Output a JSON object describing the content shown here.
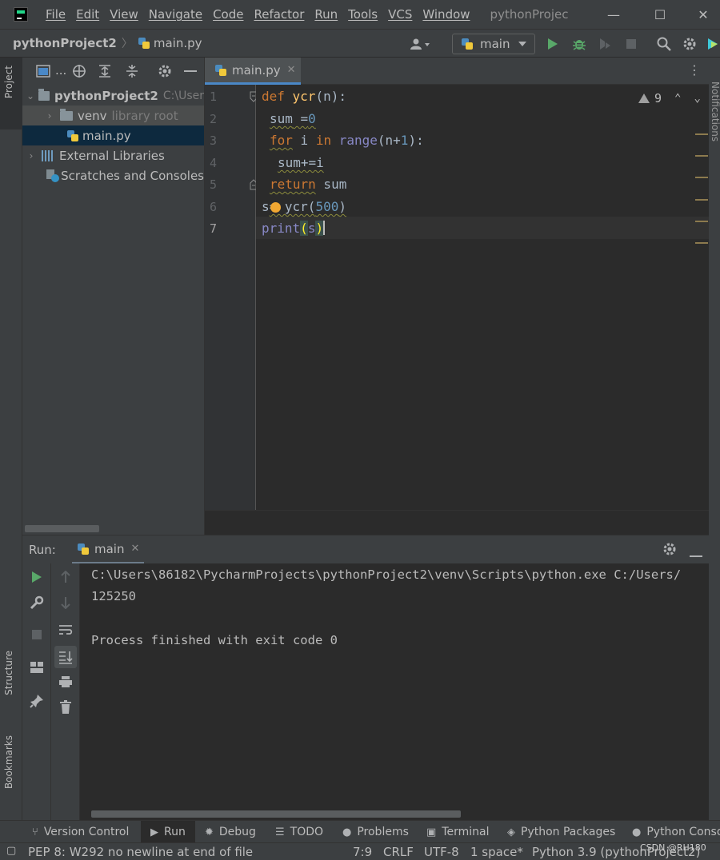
{
  "menu": {
    "items": [
      "File",
      "Edit",
      "View",
      "Navigate",
      "Code",
      "Refactor",
      "Run",
      "Tools",
      "VCS",
      "Window"
    ],
    "window_title": "pythonProjec",
    "minimize": "—",
    "maximize": "☐",
    "close": "✕"
  },
  "navbar": {
    "project": "pythonProject2",
    "file": "main.py",
    "run_config": "main"
  },
  "project_tree": {
    "root_name": "pythonProject2",
    "root_path": "C:\\User",
    "venv_label": "venv",
    "venv_hint": "library root",
    "file_label": "main.py",
    "external_libraries": "External Libraries",
    "scratches": "Scratches and Consoles",
    "toolbar_ellipsis": "..."
  },
  "editor": {
    "tab_label": "main.py",
    "warning_count": "9",
    "line_numbers": [
      "1",
      "2",
      "3",
      "4",
      "5",
      "6",
      "7"
    ],
    "code": {
      "l1_kw": "def ",
      "l1_fn": "ycr",
      "l1_rest": "(n):",
      "l2_var": "sum",
      "l2_op": " =",
      "l2_num": "0",
      "l3_kw1": "for",
      "l3_mid": " i ",
      "l3_kw2": "in",
      "l3_sp": " ",
      "l3_bi": "range",
      "l3_open": "(n+",
      "l3_num": "1",
      "l3_close": "):",
      "l4": "sum+=i",
      "l5_kw": "return",
      "l5_rest": " sum",
      "l6_a": "s",
      "l6_b": "= ycr(",
      "l6_num": "500",
      "l6_c": ")",
      "l7_fn": "print",
      "l7_open": "(",
      "l7_arg": "s",
      "l7_close": ")"
    }
  },
  "run": {
    "title": "Run:",
    "tab_label": "main",
    "console_lines": [
      "C:\\Users\\86182\\PycharmProjects\\pythonProject2\\venv\\Scripts\\python.exe C:/Users/",
      "125250",
      "",
      "Process finished with exit code 0"
    ]
  },
  "left_strip": {
    "project_tab": "Project",
    "structure_tab": "Structure",
    "bookmarks_tab": "Bookmarks"
  },
  "right_strip": {
    "notifications_tab": "Notifications"
  },
  "tool_windows": [
    "Version Control",
    "Run",
    "Debug",
    "TODO",
    "Problems",
    "Terminal",
    "Python Packages",
    "Python Conso"
  ],
  "status": {
    "message": "PEP 8: W292 no newline at end of file",
    "position": "7:9",
    "line_sep": "CRLF",
    "encoding": "UTF-8",
    "indent": "1 space*",
    "interpreter": "Python 3.9 (pythonProject2)"
  },
  "watermark": "CSDN @RH180",
  "colors": {
    "background": "#2b2b2b",
    "panel": "#3c3f41",
    "keyword": "#cc7832",
    "function": "#ffc66d",
    "number": "#6897bb",
    "builtin": "#8888c6",
    "run_green": "#59a869",
    "tab_accent": "#4a88c7"
  },
  "icons": {
    "app": "pycharm-logo-icon",
    "run": "run-icon",
    "debug": "bug-icon",
    "search": "search-icon",
    "settings": "gear-icon"
  }
}
